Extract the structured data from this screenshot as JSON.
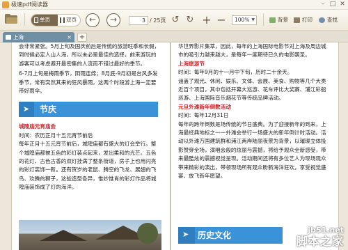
{
  "titlebar": {
    "app_title": "极速pdf阅读器",
    "min_glyph": "–",
    "max_glyph": "□",
    "close_glyph": "✕"
  },
  "toolbar": {
    "view_single": "单页",
    "view_double": "双页",
    "back_glyph": "←",
    "forward_glyph": "→",
    "page_current": "3",
    "page_total": "/ 25页",
    "undo_glyph": "↺",
    "redo_glyph": "↻",
    "zoom_in_glyph": "+",
    "zoom_out_glyph": "−",
    "zoom_value": "100%",
    "zoom_arrow": "▼",
    "background_label": "背景",
    "print_label": "打印",
    "search_label": "查找"
  },
  "tabs": {
    "active_tab": "上海",
    "close_glyph": "×",
    "add_glyph": "+"
  },
  "doc": {
    "left": {
      "p1": "会非常紧张。5月上旬及国庆前后是传统的旅游旺季和长假，到时候必定人山人海，所以未必是最佳的选择，前来游玩的游客可以考虑避开最密集的人流而不错过最好的季节。",
      "p2": "6-7月上旬是梅雨季节，阴雨连绵；8月底-9月初是台风多发季节，常有突然其来的狂风暴雨，这两个时段游上海一定要带好雨伞。",
      "section1_arrow": "➤",
      "section1_title": "节庆",
      "h1": "城隍庙元宵庙会",
      "t1": "时间：农历正月十五元宵节前后",
      "p3": "每年正月十五元宵节前后，城隍庙都有盛大的灯会举行。整个城隍庙都被五色的彩灯装点起来，发出柔和的光芒。五色的花灯、古色古香的双灯挂满了整条街道，房子上也用闪亮的彩灯装饰一新。还有贺岁的老鼠、腾空的飞龙、展翅的飞鸟、欢腾的狮子，这些造型各异，惟妙惟肖的彩灯作品将城隍庙装饰成了灯的海洋。"
    },
    "right": {
      "p1": "华世界影片集萃，因此，每年的上海国际电影节对上海及周边城市的吸引力越来越大，是每年一度期待已久的电影朝圣。",
      "h1": "上海旅游节",
      "t1": "时间：每年9月的十一月中下旬，历时二十余天。",
      "p2": "涵盖了观光、休闲、娱乐、文体、会展、美食、购物等几个大类近百个项目，其中包括开幕大巡游、花车评比大奖赛、浦江彩船巡游、上海国际音乐烟花节等传统品牌活动。",
      "h2": "元旦外滩新年倒数活动",
      "t2": "时间：每年12月31日",
      "p3": "每年的跨年倒数是场传统的节日盛典。为了迎接新年的到来，上海最经典地标之一一外滩会举行一场盛大的新年倒计时活动。活动以外滩万国建筑群和浦江两岸陆丽夜景为背景，以璀璨立体投影赞穿全场，演唱会般的炫丽与震撼，将给予观众全新感受，带来最酷炫的震撼视觉呈现。活动期间还将有多位艺人为现场观众带来精彩的演出，带领现场所有观众盼新海洋狂欢，享受视觉盛宴、放飞新年愿望。",
      "section2_arrow": "➤",
      "section2_title": "历史文化"
    }
  },
  "watermark": {
    "site": "jb51.net",
    "name": "脚本之家"
  },
  "colors": {
    "banner_blue": "#3a92d8",
    "heading_red": "#c2292a",
    "tab_blue": "#6f8fa5"
  },
  "icons": [
    "app-logo-icon",
    "folder-open-icon",
    "single-page-icon",
    "double-page-icon",
    "back-arrow-icon",
    "forward-arrow-icon",
    "undo-icon",
    "redo-icon",
    "zoom-in-icon",
    "zoom-out-icon",
    "background-icon",
    "print-icon",
    "search-icon",
    "document-tab-icon"
  ]
}
